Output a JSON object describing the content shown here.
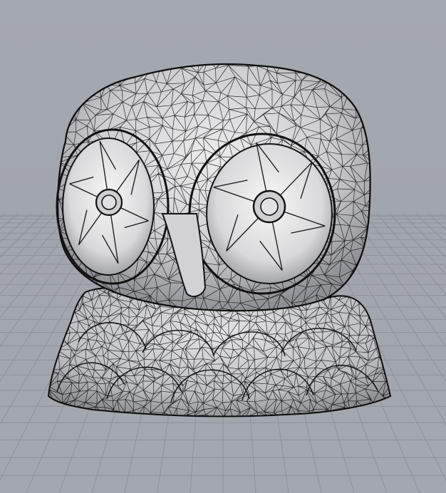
{
  "viewport": {
    "label": "",
    "background": "#a2a7ad",
    "grid_color": "#8d9298",
    "wire_color": "#0c0c0c",
    "surface_color": "#d7d7d9",
    "highlight_color": "#f2f2f2"
  },
  "model": {
    "subject": "owl-figurine",
    "display_mode": "wireframe-shaded"
  }
}
